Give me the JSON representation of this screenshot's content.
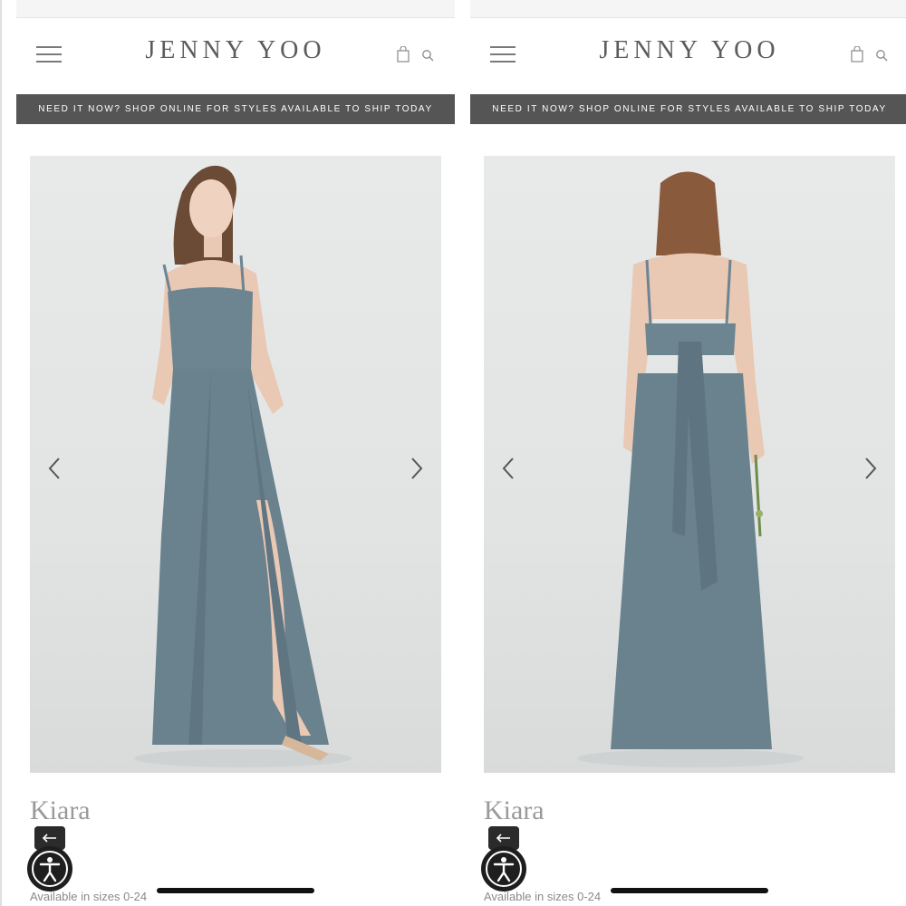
{
  "panels": [
    {
      "logo": "JENNY YOO",
      "banner": "NEED IT NOW? SHOP ONLINE FOR STYLES AVAILABLE TO SHIP TODAY",
      "product_name": "Kiara",
      "sizes_text": "Available in sizes 0-24",
      "view": "front"
    },
    {
      "logo": "JENNY YOO",
      "banner": "NEED IT NOW? SHOP ONLINE FOR STYLES AVAILABLE TO SHIP TODAY",
      "product_name": "Kiara",
      "sizes_text": "Available in sizes 0-24",
      "view": "back"
    }
  ],
  "icons": {
    "menu": "hamburger-menu-icon",
    "bag": "shopping-bag-icon",
    "search": "search-icon",
    "prev": "chevron-left-icon",
    "next": "chevron-right-icon",
    "back": "back-arrow-icon",
    "accessibility": "accessibility-icon"
  },
  "colors": {
    "banner_bg": "#555555",
    "dress": "#6d8591",
    "photo_bg": "#e6e8e8"
  }
}
